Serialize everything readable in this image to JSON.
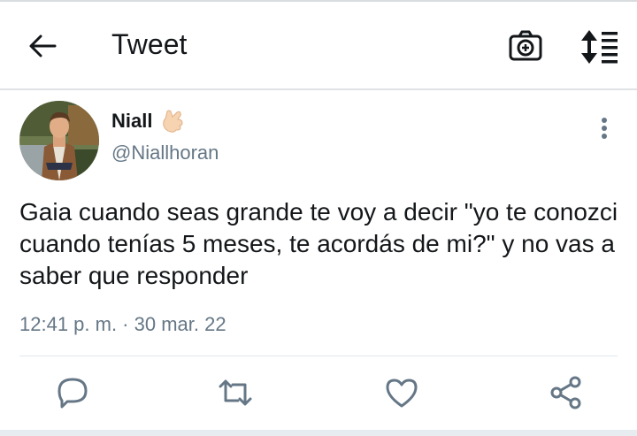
{
  "header": {
    "title": "Tweet",
    "back_icon": "arrow-left-icon",
    "camera_icon": "camera-plus-icon",
    "sort_icon": "sort-lines-icon"
  },
  "tweet": {
    "display_name": "Niall",
    "handle": "@Niallhoran",
    "name_emoji": "thumbs-hand-emoji",
    "text": "Gaia cuando seas grande te voy a decir \"yo te conozci cuando tenías 5 meses, te acordás de mi?\" y no vas a saber que responder",
    "timestamp": "12:41 p. m. · 30 mar. 22"
  },
  "actions": [
    {
      "icon": "reply-icon"
    },
    {
      "icon": "retweet-icon"
    },
    {
      "icon": "like-icon"
    },
    {
      "icon": "share-icon"
    }
  ],
  "colors": {
    "text_primary": "#14171a",
    "text_secondary": "#657786",
    "action_icon": "#657786"
  }
}
